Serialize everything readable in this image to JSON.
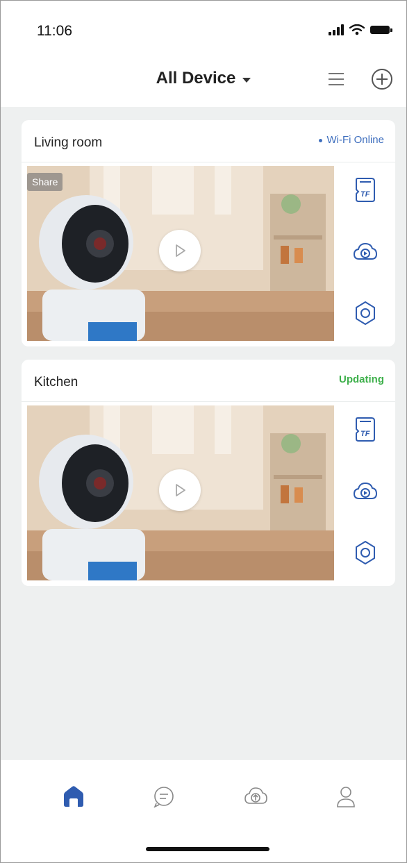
{
  "status_bar": {
    "time": "11:06"
  },
  "header": {
    "title": "All Device",
    "menu_icon": "menu-icon",
    "add_icon": "add-circle-icon"
  },
  "devices": [
    {
      "name": "Living room",
      "status": "Wi-Fi Online",
      "status_color": "#3f6fbe",
      "share_label": "Share"
    },
    {
      "name": "Kitchen",
      "status": "Updating",
      "status_color": "#3eb04b"
    }
  ],
  "side_actions": [
    "tf-card-icon",
    "cloud-storage-icon",
    "settings-icon"
  ],
  "tabbar": {
    "tabs": [
      "home-icon",
      "message-icon",
      "cloud-upload-icon",
      "profile-icon"
    ],
    "active": 0,
    "active_color": "#2f5cb0"
  }
}
